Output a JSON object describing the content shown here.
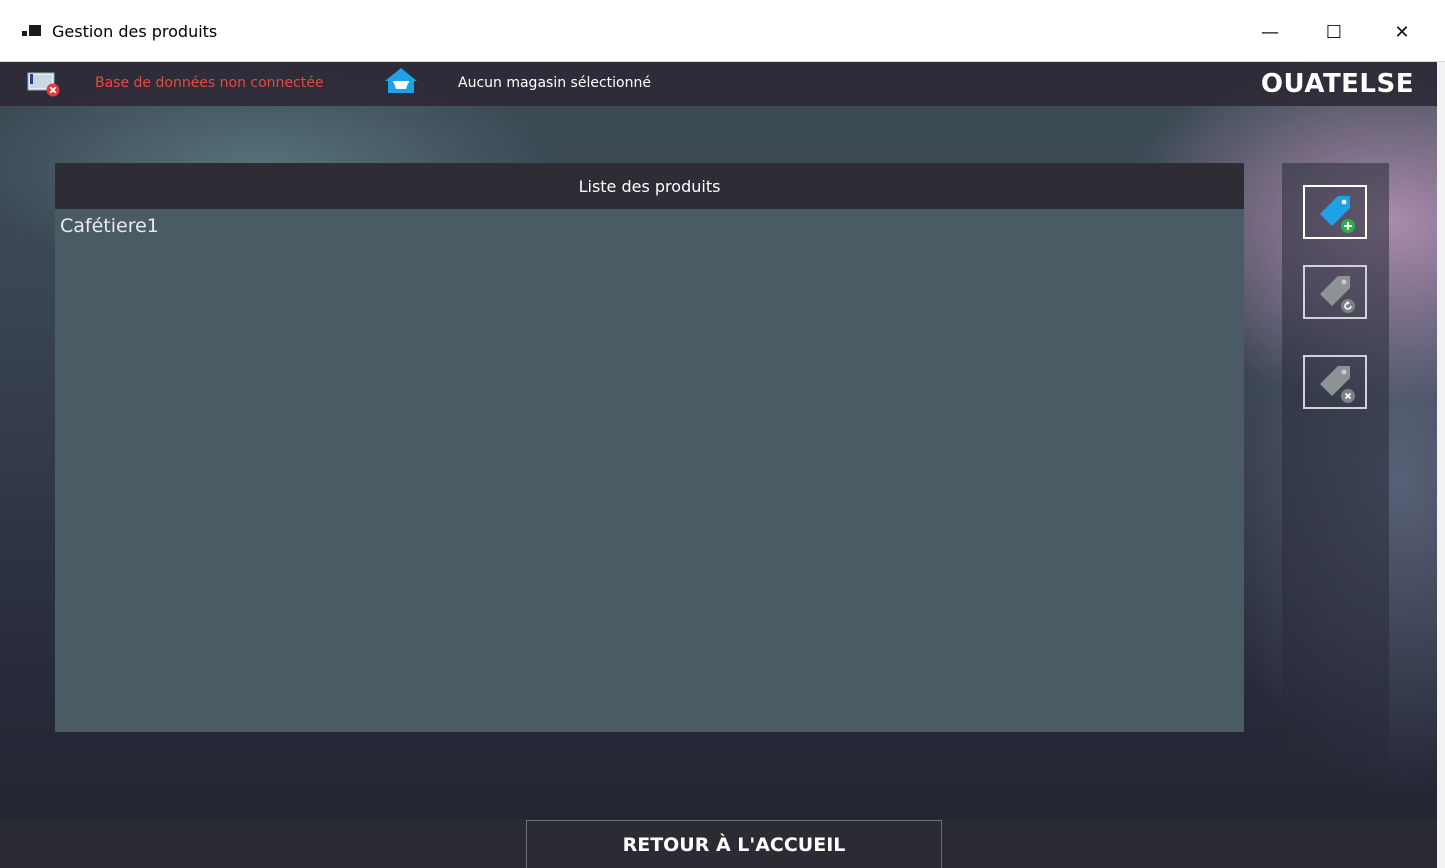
{
  "window": {
    "title": "Gestion des produits",
    "minimize_glyph": "—",
    "maximize_glyph": "☐",
    "close_glyph": "✕"
  },
  "header": {
    "db_icon": "database-disconnected-icon",
    "db_status": "Base de données non connectée",
    "store_icon": "store-basket-icon",
    "store_status": "Aucun magasin sélectionné",
    "brand": "OUATELSE"
  },
  "product_list": {
    "header": "Liste des produits",
    "items": [
      "Cafétiere1"
    ]
  },
  "actions": [
    {
      "name": "add-product",
      "icon": "tag-add-icon",
      "enabled": true
    },
    {
      "name": "update-product",
      "icon": "tag-refresh-icon",
      "enabled": false
    },
    {
      "name": "delete-product",
      "icon": "tag-delete-icon",
      "enabled": false
    }
  ],
  "footer": {
    "home_button": "RETOUR À L'ACCUEIL"
  },
  "colors": {
    "db_status": "#e8493f",
    "accent_blue": "#1ea1e6",
    "add_green": "#2eaf4a",
    "list_bg": "#4a5b63",
    "list_header_bg": "#2e2c35"
  }
}
